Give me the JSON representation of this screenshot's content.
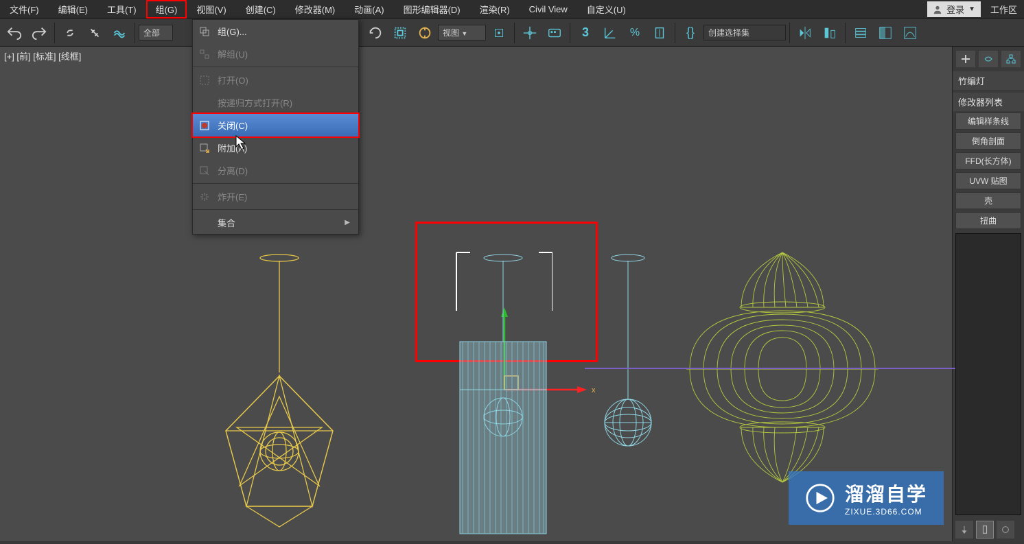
{
  "menubar": {
    "items": [
      {
        "label": "文件(F)"
      },
      {
        "label": "编辑(E)"
      },
      {
        "label": "工具(T)"
      },
      {
        "label": "组(G)",
        "highlighted": true
      },
      {
        "label": "视图(V)"
      },
      {
        "label": "创建(C)"
      },
      {
        "label": "修改器(M)"
      },
      {
        "label": "动画(A)"
      },
      {
        "label": "图形编辑器(D)"
      },
      {
        "label": "渲染(R)"
      },
      {
        "label": "Civil View"
      },
      {
        "label": "自定义(U)"
      }
    ],
    "login_label": "登录",
    "workspace_label": "工作区"
  },
  "toolbar": {
    "all_label": "全部",
    "coord_dropdown": "视图",
    "selectset_placeholder": "创建选择集"
  },
  "dropdown": {
    "items": [
      {
        "label": "组(G)..."
      },
      {
        "label": "解组(U)",
        "disabled": true
      },
      {
        "label": "打开(O)",
        "disabled": true
      },
      {
        "label": "按递归方式打开(R)",
        "disabled": true
      },
      {
        "label": "关闭(C)",
        "hover": true,
        "hl": true
      },
      {
        "label": "附加(A)"
      },
      {
        "label": "分离(D)",
        "disabled": true
      },
      {
        "label": "炸开(E)",
        "disabled": true
      },
      {
        "label": "集合",
        "submenu": true
      }
    ]
  },
  "viewport": {
    "label": "[+] [前] [标准] [线框]"
  },
  "sidepanel": {
    "object_name": "竹编灯",
    "modifier_list_label": "修改器列表",
    "modifiers": [
      "编辑样条线",
      "倒角剖面",
      "FFD(长方体)",
      "UVW 贴图",
      "壳",
      "扭曲"
    ]
  },
  "watermark": {
    "title": "溜溜自学",
    "url": "ZIXUE.3D66.COM"
  },
  "colors": {
    "accent_cyan": "#5bc7d8",
    "wireframe_yellow": "#e6c84a",
    "wireframe_cyan": "#8fd4e4",
    "wireframe_olive": "#b5c93f",
    "highlight_red": "#ff0000"
  }
}
